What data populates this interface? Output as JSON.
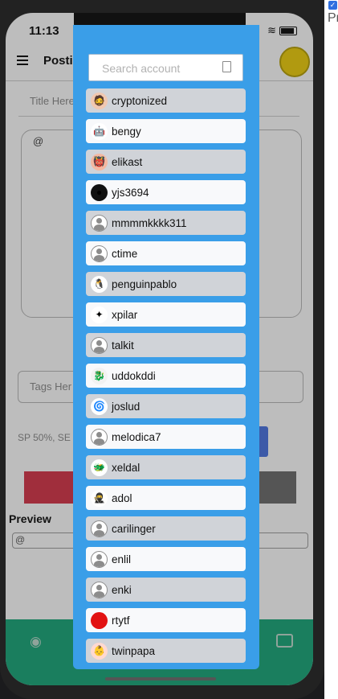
{
  "status": {
    "time": "11:13"
  },
  "app": {
    "title": "Posti"
  },
  "form": {
    "title_placeholder": "Title Here",
    "body_prefix": "@",
    "tags_placeholder": "Tags Her",
    "sp_text": "SP 50%, SE",
    "preview_label": "Preview",
    "preview_value": "@"
  },
  "modal": {
    "search_placeholder": "Search account",
    "accounts": [
      {
        "name": "cryptonized",
        "avatar": "custom",
        "color": "#f1c8b0",
        "icon": "🧔"
      },
      {
        "name": "bengy",
        "avatar": "custom",
        "color": "#ffffff",
        "icon": "🤖"
      },
      {
        "name": "elikast",
        "avatar": "custom",
        "color": "#f4b7a0",
        "icon": "👹"
      },
      {
        "name": "yjs3694",
        "avatar": "custom",
        "color": "#111111",
        "icon": "●"
      },
      {
        "name": "mmmmkkkk311",
        "avatar": "default"
      },
      {
        "name": "ctime",
        "avatar": "default"
      },
      {
        "name": "penguinpablo",
        "avatar": "custom",
        "color": "#ffffff",
        "icon": "🐧"
      },
      {
        "name": "xpilar",
        "avatar": "custom",
        "color": "#ffffff",
        "icon": "✦"
      },
      {
        "name": "talkit",
        "avatar": "default"
      },
      {
        "name": "uddokddi",
        "avatar": "custom",
        "color": "#f2f2f2",
        "icon": "🐉"
      },
      {
        "name": "joslud",
        "avatar": "custom",
        "color": "#ffffff",
        "icon": "🌀"
      },
      {
        "name": "melodica7",
        "avatar": "default"
      },
      {
        "name": "xeldal",
        "avatar": "custom",
        "color": "#ffffff",
        "icon": "🐲"
      },
      {
        "name": "adol",
        "avatar": "custom",
        "color": "#ffffff",
        "icon": "🥷"
      },
      {
        "name": "carilinger",
        "avatar": "default"
      },
      {
        "name": "enlil",
        "avatar": "default"
      },
      {
        "name": "enki",
        "avatar": "default"
      },
      {
        "name": "rtytf",
        "avatar": "custom",
        "color": "#e21212",
        "icon": ""
      },
      {
        "name": "twinpapa",
        "avatar": "custom",
        "color": "#ffd9d0",
        "icon": "👶"
      }
    ]
  }
}
